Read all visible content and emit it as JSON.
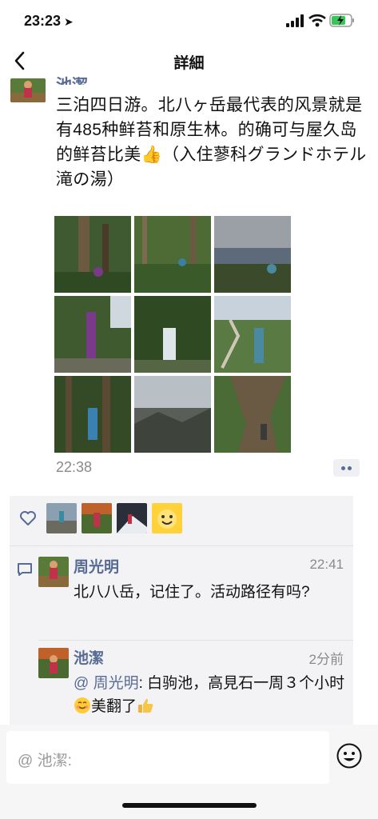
{
  "status_bar": {
    "time": "23:23",
    "icons": [
      "location-arrow-icon",
      "signal-icon",
      "wifi-icon",
      "battery-charging-icon"
    ]
  },
  "nav": {
    "title": "詳細",
    "back_icon": "chevron-left-icon"
  },
  "post": {
    "author": "池潔",
    "text": "三泊四日游。北八ヶ岳最代表的风景就是有485种鲜苔和原生林。的确可与屋久岛的鲜苔比美👍（入住蓼科グランドホテル 滝の湯）",
    "photos": [
      "forest-trail",
      "mossy-forest",
      "summit-view",
      "tree-hiker",
      "waterfall-moss",
      "deadwood-hiker",
      "tall-forest",
      "rocky-peak",
      "giant-tree"
    ],
    "time": "22:38"
  },
  "likes": {
    "icon": "heart-icon",
    "avatars": [
      "hiker-rocks",
      "hiker-autumn",
      "hiker-snow",
      "smiley-sticker"
    ]
  },
  "comments": [
    {
      "name": "周光明",
      "time": "22:41",
      "text": "北八八岳，记住了。活动路径有吗?"
    },
    {
      "name": "池潔",
      "time": "2分前",
      "mention": "@ 周光明",
      "text": ": 白驹池，高見石一周３个小时",
      "text_after": "美翻了"
    }
  ],
  "input": {
    "placeholder": "@ 池潔:",
    "emoji_icon": "emoji-face-icon"
  },
  "colors": {
    "link": "#576b95",
    "panel": "#f3f3f5"
  }
}
